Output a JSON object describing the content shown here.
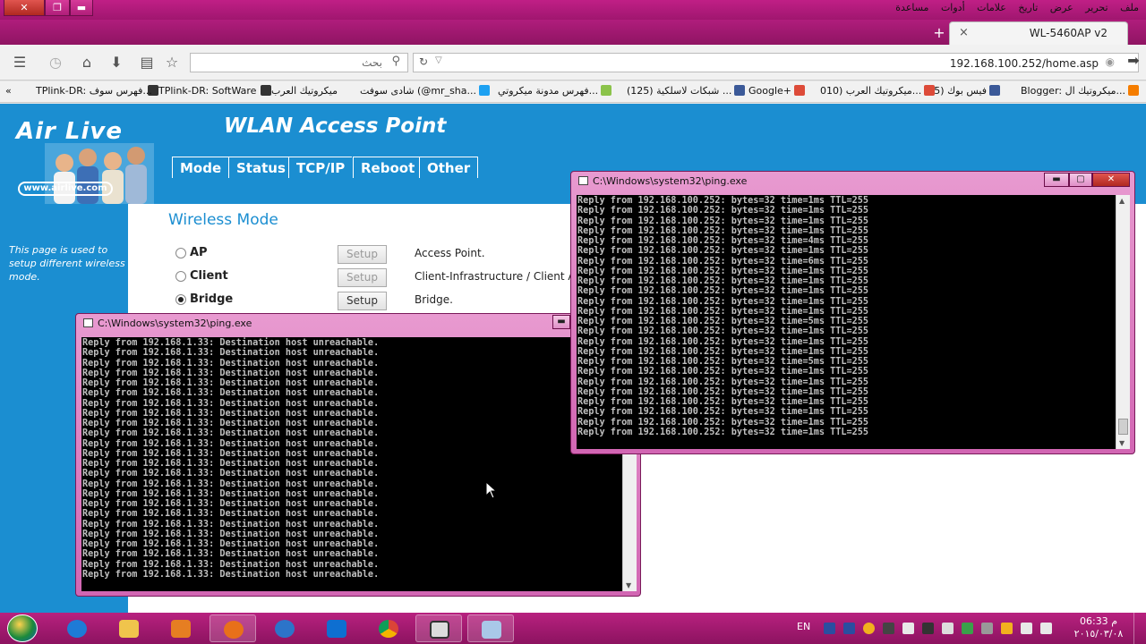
{
  "browser": {
    "menu": [
      "ملف",
      "تحرير",
      "عرض",
      "تاريخ",
      "علامات",
      "أدوات",
      "مساعدة"
    ],
    "tab_title": "WL-5460AP v2",
    "tab_close": "×",
    "new_tab": "+",
    "search_placeholder": "بحث",
    "url": "192.168.100.252/home.asp",
    "bookmarks": [
      "Blogger: ميكروتيك ال...",
      "(55) فيس بوك",
      "ميكروتيك العرب (010...",
      "Google+",
      "(125) شبكات لاسلكية ...",
      "فهرس مدونة ميكروتي...",
      "شادى سوفت (@mr_sha...",
      "ميكروتيك العرب",
      "TPlink-DR: SoftWare",
      "TPlink-DR: فهرس سوف..."
    ],
    "bookmarks_overflow": "«"
  },
  "router": {
    "logo": "Air Live",
    "logo_url": "www.airlive.com",
    "page_title": "WLAN Access Point",
    "nav": [
      "Mode",
      "Status",
      "TCP/IP",
      "Reboot",
      "Other"
    ],
    "left_note": "This page is used to setup different wireless mode.",
    "section_title": "Wireless Mode",
    "modes": [
      {
        "label": "AP",
        "button": "Setup",
        "desc": "Access Point."
      },
      {
        "label": "Client",
        "button": "Setup",
        "desc": "Client-Infrastructure / Client Ad-Hoc"
      },
      {
        "label": "Bridge",
        "button": "Setup",
        "desc": "Bridge."
      }
    ],
    "selected_mode": "Bridge"
  },
  "console_left": {
    "title": "C:\\Windows\\system32\\ping.exe",
    "line": "Reply from 192.168.1.33: Destination host unreachable.",
    "line_count": 24
  },
  "console_right": {
    "title": "C:\\Windows\\system32\\ping.exe",
    "times": [
      "1ms",
      "1ms",
      "1ms",
      "1ms",
      "4ms",
      "1ms",
      "6ms",
      "1ms",
      "1ms",
      "1ms",
      "1ms",
      "1ms",
      "5ms",
      "1ms",
      "1ms",
      "1ms",
      "5ms",
      "1ms",
      "1ms",
      "1ms",
      "1ms",
      "1ms",
      "1ms",
      "1ms"
    ],
    "ip": "192.168.100.252",
    "bytes": "32",
    "ttl": "255"
  },
  "taskbar": {
    "lang": "EN",
    "time": "06:33 م",
    "date": "٢٠١٥/٠٣/٠٨"
  },
  "colors": {
    "accent": "#c01f86",
    "router_blue": "#1b8ed1"
  }
}
